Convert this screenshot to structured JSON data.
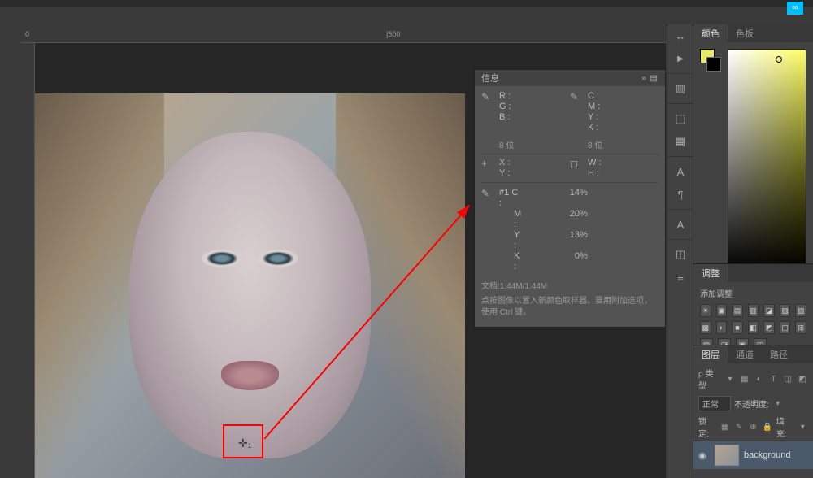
{
  "ruler": {
    "mark0": "0",
    "mark500": "|500"
  },
  "info_panel": {
    "title": "信息",
    "menu_icon": "»  ▤",
    "rgb": {
      "r": "R :",
      "g": "G :",
      "b": "B :",
      "mode": "8 位"
    },
    "cmyk": {
      "c": "C :",
      "m": "M :",
      "y": "Y :",
      "k": "K :",
      "mode": "8 位"
    },
    "xy": {
      "x": "X :",
      "y": "Y :"
    },
    "wh": {
      "w": "W :",
      "h": "H :"
    },
    "sample": {
      "id": "#1",
      "c_lbl": "C :",
      "c_val": "14%",
      "m_lbl": "M :",
      "m_val": "20%",
      "y_lbl": "Y :",
      "y_val": "13%",
      "k_lbl": "K :",
      "k_val": "0%"
    },
    "doc": "文档:1.44M/1.44M",
    "help": "点按图像以置入新颜色取样器。要用附加选项，使用 Ctrl 键。"
  },
  "right_strip": {
    "collapse": "↔",
    "play": "▶",
    "histogram": "▥",
    "nav": "⬚",
    "swatch": "▦",
    "type": "A",
    "char": "¶",
    "paragraph": "A",
    "cube": "◫",
    "ruler": "≡"
  },
  "color_panel": {
    "tab_color": "颜色",
    "tab_swatches": "色板"
  },
  "adjust_panel": {
    "tab": "调整",
    "label": "添加调整",
    "icons_r1": [
      "☀",
      "▣",
      "▤",
      "▥",
      "◪",
      "▨",
      "▧"
    ],
    "icons_r2": [
      "▩",
      "◐",
      "■",
      "◧",
      "◩",
      "◫",
      "⊞"
    ],
    "icons_r3": [
      "▤",
      "◪",
      "▣",
      "◫"
    ]
  },
  "layers_panel": {
    "tab_layers": "图层",
    "tab_channels": "通道",
    "tab_paths": "路径",
    "kind_label": "ρ 类型",
    "kind_dropdown": "▾",
    "filter_icons": [
      "▦",
      "◐",
      "T",
      "◫",
      "◩"
    ],
    "blend_mode": "正常",
    "opacity_label": "不透明度:",
    "opacity_value": "▾",
    "lock_label": "锁定:",
    "lock_icons": [
      "▦",
      "✎",
      "⊕",
      "🔒"
    ],
    "fill_label": "填充:",
    "fill_value": "▾",
    "layer": {
      "name": "background"
    }
  }
}
